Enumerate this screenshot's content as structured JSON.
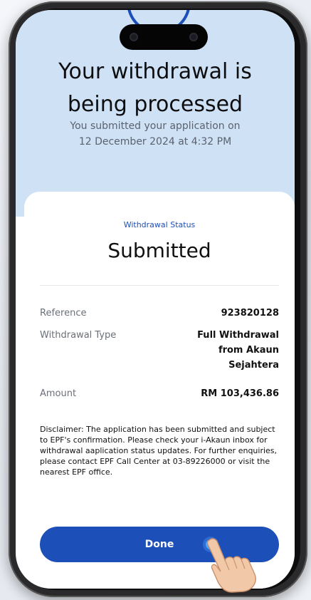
{
  "header": {
    "title_line1": "Your withdrawal is",
    "title_line2": "being processed",
    "subtitle_line1": "You submitted your application on",
    "subtitle_line2": "12 December 2024 at 4:32 PM"
  },
  "status": {
    "label": "Withdrawal Status",
    "value": "Submitted"
  },
  "details": [
    {
      "key": "Reference",
      "value": "923820128"
    },
    {
      "key": "Withdrawal Type",
      "value_line1": "Full Withdrawal",
      "value_line2": "from Akaun",
      "value_line3": "Sejahtera"
    },
    {
      "key": "Amount",
      "value": "RM 103,436.86"
    }
  ],
  "disclaimer": "Disclaimer: The application has been submitted and subject to EPF's confirmation. Please check your i-Akaun inbox for withdrawal aaplication status updates. For further enquiries, please contact EPF Call Center at 03-89226000 or visit the nearest EPF office.",
  "actions": {
    "done_label": "Done"
  },
  "colors": {
    "accent": "#1d4fb8",
    "hero_bg": "#cfe1f5"
  }
}
